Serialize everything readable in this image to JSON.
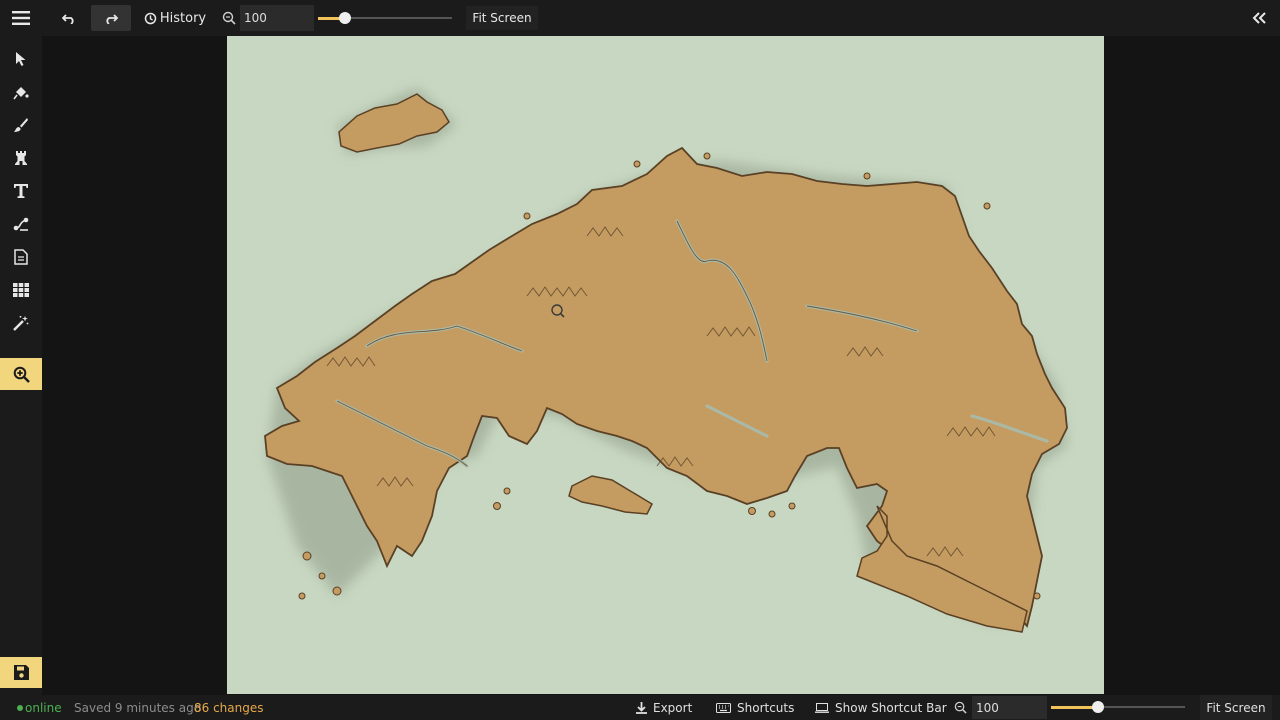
{
  "toolbar": {
    "history_label": "History",
    "zoom_value": "100",
    "zoom_level": 0.2,
    "fit_screen_label": "Fit Screen"
  },
  "tools": [
    "select-tool",
    "fill-tool",
    "brush-tool",
    "symbol-tool",
    "text-tool",
    "path-tool",
    "notes-tool",
    "grid-tool",
    "effects-tool",
    "zoom-tool",
    "save-tool"
  ],
  "status": {
    "online_label": "online",
    "saved_text": "Saved 9 minutes ago",
    "changes_text": "86 changes",
    "export_label": "Export",
    "shortcuts_label": "Shortcuts",
    "show_shortcut_bar_label": "Show Shortcut Bar",
    "zoom_value": "100",
    "zoom_level": 0.35,
    "fit_screen_label": "Fit Screen"
  },
  "colors": {
    "accent": "#f2d67e",
    "online": "#4caf50",
    "changes": "#e6a84a",
    "land": "#c49c62",
    "sea": "#c7d6c0"
  }
}
